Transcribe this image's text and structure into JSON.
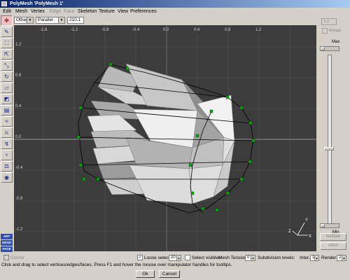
{
  "window": {
    "title": "PolyMesh 'PolyMesh 1'"
  },
  "menu": {
    "items": [
      {
        "label": "Edit",
        "enabled": true
      },
      {
        "label": "Mesh",
        "enabled": true
      },
      {
        "label": "Vertex",
        "enabled": true
      },
      {
        "label": "Edge",
        "enabled": false
      },
      {
        "label": "Face",
        "enabled": false
      },
      {
        "label": "Skeleton",
        "enabled": true
      },
      {
        "label": "Texture",
        "enabled": true
      },
      {
        "label": "View",
        "enabled": true
      },
      {
        "label": "Preferences",
        "enabled": true
      }
    ]
  },
  "toolbar": {
    "view_select": "Other",
    "projection_select": "Parallel",
    "scale_value": "210.1"
  },
  "left_tools": {
    "icons": [
      "move-icon",
      "pen-icon",
      "bevel-icon",
      "extrude-icon",
      "scale-icon",
      "rotate-icon",
      "skew-icon",
      "taper-icon",
      "thicken-icon",
      "pinch-icon",
      "knife-icon",
      "bend-icon",
      "skeleton-icon",
      "weight-icon",
      "camera-icon"
    ],
    "brand_top": "ART",
    "brand_mid": "EDGE",
    "brand_bot": "FACE"
  },
  "viewport": {
    "x_ticks": [
      "-1.6",
      "-1.2",
      "-0.8",
      "-0.4",
      "0.0",
      "0.4",
      "0.8",
      "1.2"
    ],
    "y_ticks": [
      "1.2",
      "0.8",
      "0.4",
      "0.0",
      "-0.4",
      "-0.8",
      "-1.2"
    ],
    "axis_labels": {
      "x": "X",
      "y": "Y",
      "z": "Z"
    },
    "colors": {
      "background": "#3c3c3c",
      "grid": "#555555",
      "axis": "#7a7a7a",
      "vertex": "#00b000",
      "wire": "#000000"
    }
  },
  "right_panel": {
    "value": "1.0",
    "retain_label": "Retain",
    "max_label": "Max",
    "min_label": "Min",
    "validate_label": "Validate",
    "abort_label": "Abort",
    "slider_level": 0.46
  },
  "bottom": {
    "corner_label": "Corner",
    "loose_select_label": "Loose select",
    "loose_select_checked": true,
    "loose_select_value": "20",
    "select_visibles_label": "Select visibles",
    "mesh_tension_label": "Mesh Tension:",
    "mesh_tension_value": "0",
    "subdivision_label": "Subdivision levels:",
    "inter_label": "Inter.",
    "inter_value": "1",
    "render_label": "Render",
    "render_value": "2",
    "status_text": "Click and drag to select vertices/edges/faces. Press F1 and hover the mouse over manipulator handles for tooltips.",
    "ok_label": "Ok",
    "cancel_label": "Cancel"
  }
}
